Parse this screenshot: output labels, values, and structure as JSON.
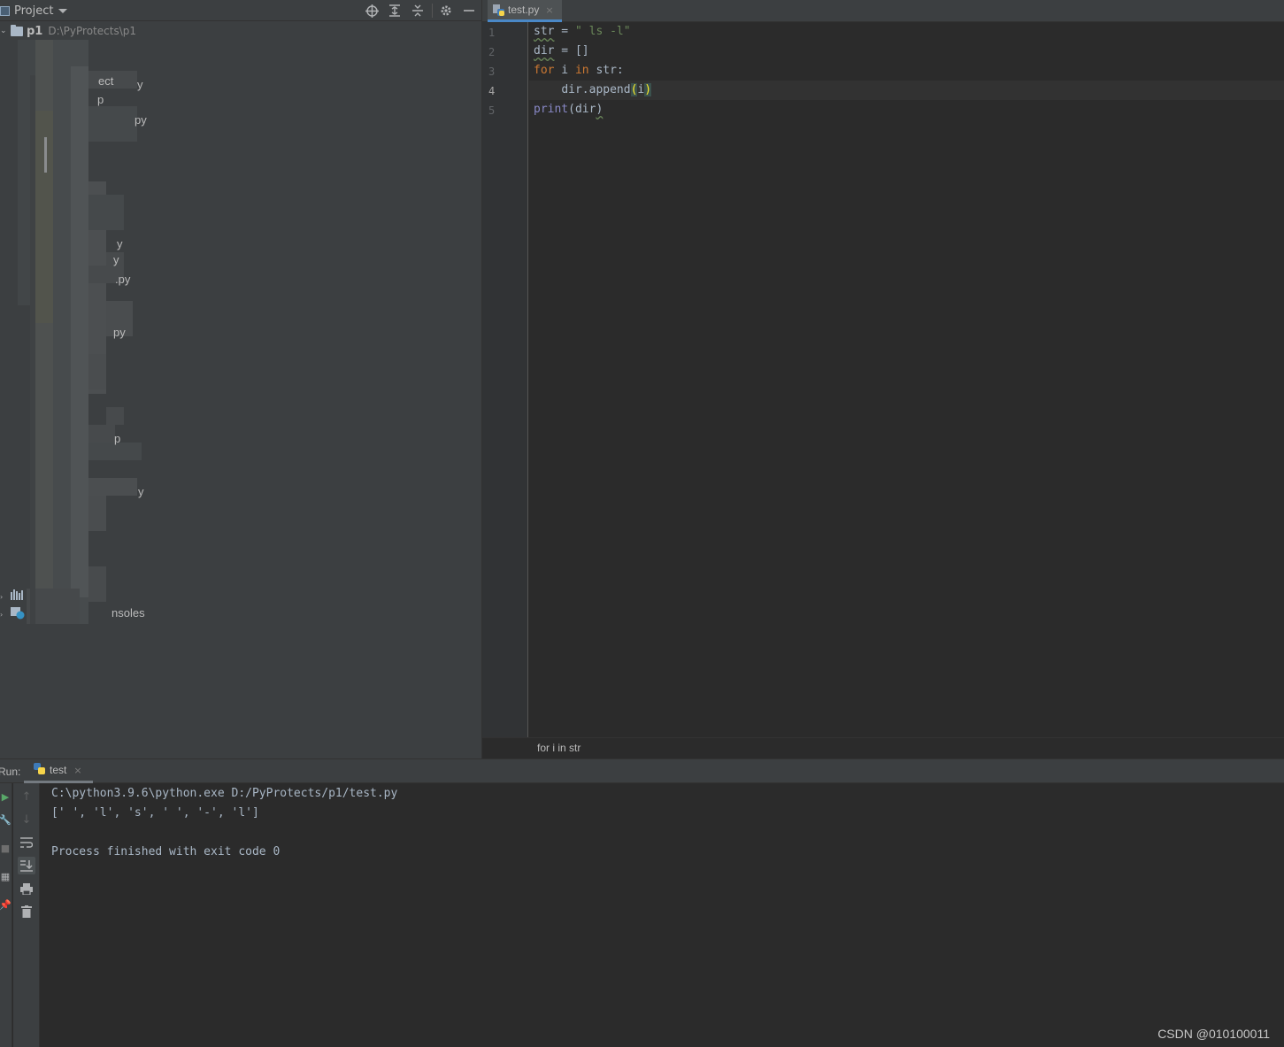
{
  "project_panel": {
    "title": "Project",
    "root": {
      "name": "p1",
      "path": "D:\\PyProtects\\p1"
    },
    "visible_fragments": [
      "ect",
      "y",
      "p",
      "py",
      "y",
      "y",
      ".py",
      "py",
      "p",
      "y",
      "nsoles"
    ]
  },
  "editor": {
    "tab": {
      "label": "test.py",
      "close": "×"
    },
    "line_numbers": [
      "1",
      "2",
      "3",
      "4",
      "5"
    ],
    "code": {
      "l1": {
        "var": "str",
        "op": " = ",
        "str": "\" ls -l\""
      },
      "l2": {
        "var": "dir",
        "op": " = []"
      },
      "l3": {
        "kw_for": "for",
        "mid": " i ",
        "kw_in": "in",
        "rest": " str:"
      },
      "l4": {
        "indent": "    ",
        "call": "dir.append",
        "open": "(",
        "arg": "i",
        "close": ")"
      },
      "l5": {
        "fn": "print",
        "open": "(",
        "arg": "dir",
        "close": ")"
      }
    },
    "breadcrumb": "for i in str"
  },
  "run_panel": {
    "label": "Run:",
    "tab": {
      "label": "test",
      "close": "×"
    },
    "console": [
      "C:\\python3.9.6\\python.exe D:/PyProtects/p1/test.py",
      "[' ', 'l', 's', ' ', '-', 'l']",
      "",
      "Process finished with exit code 0"
    ]
  },
  "watermark": "CSDN @010100011",
  "colors": {
    "panel_bg": "#3c3f41",
    "editor_bg": "#2b2b2b",
    "keyword": "#cc7832",
    "string": "#6a8759",
    "builtin": "#8888c6",
    "text": "#a9b7c6",
    "accent": "#4a88c7"
  }
}
